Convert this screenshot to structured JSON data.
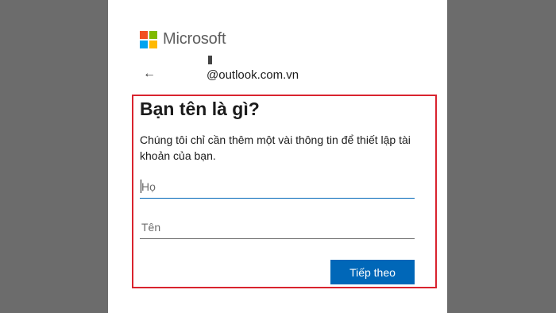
{
  "brand": {
    "name": "Microsoft",
    "logo_colors": [
      "#f25022",
      "#7fba00",
      "#00a4ef",
      "#ffb900"
    ]
  },
  "header": {
    "back_icon": "back-arrow-icon",
    "back_glyph": "←",
    "email": "@outlook.com.vn"
  },
  "form": {
    "title": "Bạn tên là gì?",
    "description": "Chúng tôi chỉ cần thêm một vài thông tin để thiết lập tài khoản của bạn.",
    "last_name_placeholder": "Họ",
    "first_name_placeholder": "Tên",
    "next_label": "Tiếp theo"
  },
  "colors": {
    "accent": "#0067b8",
    "highlight_border": "#d9232e"
  }
}
